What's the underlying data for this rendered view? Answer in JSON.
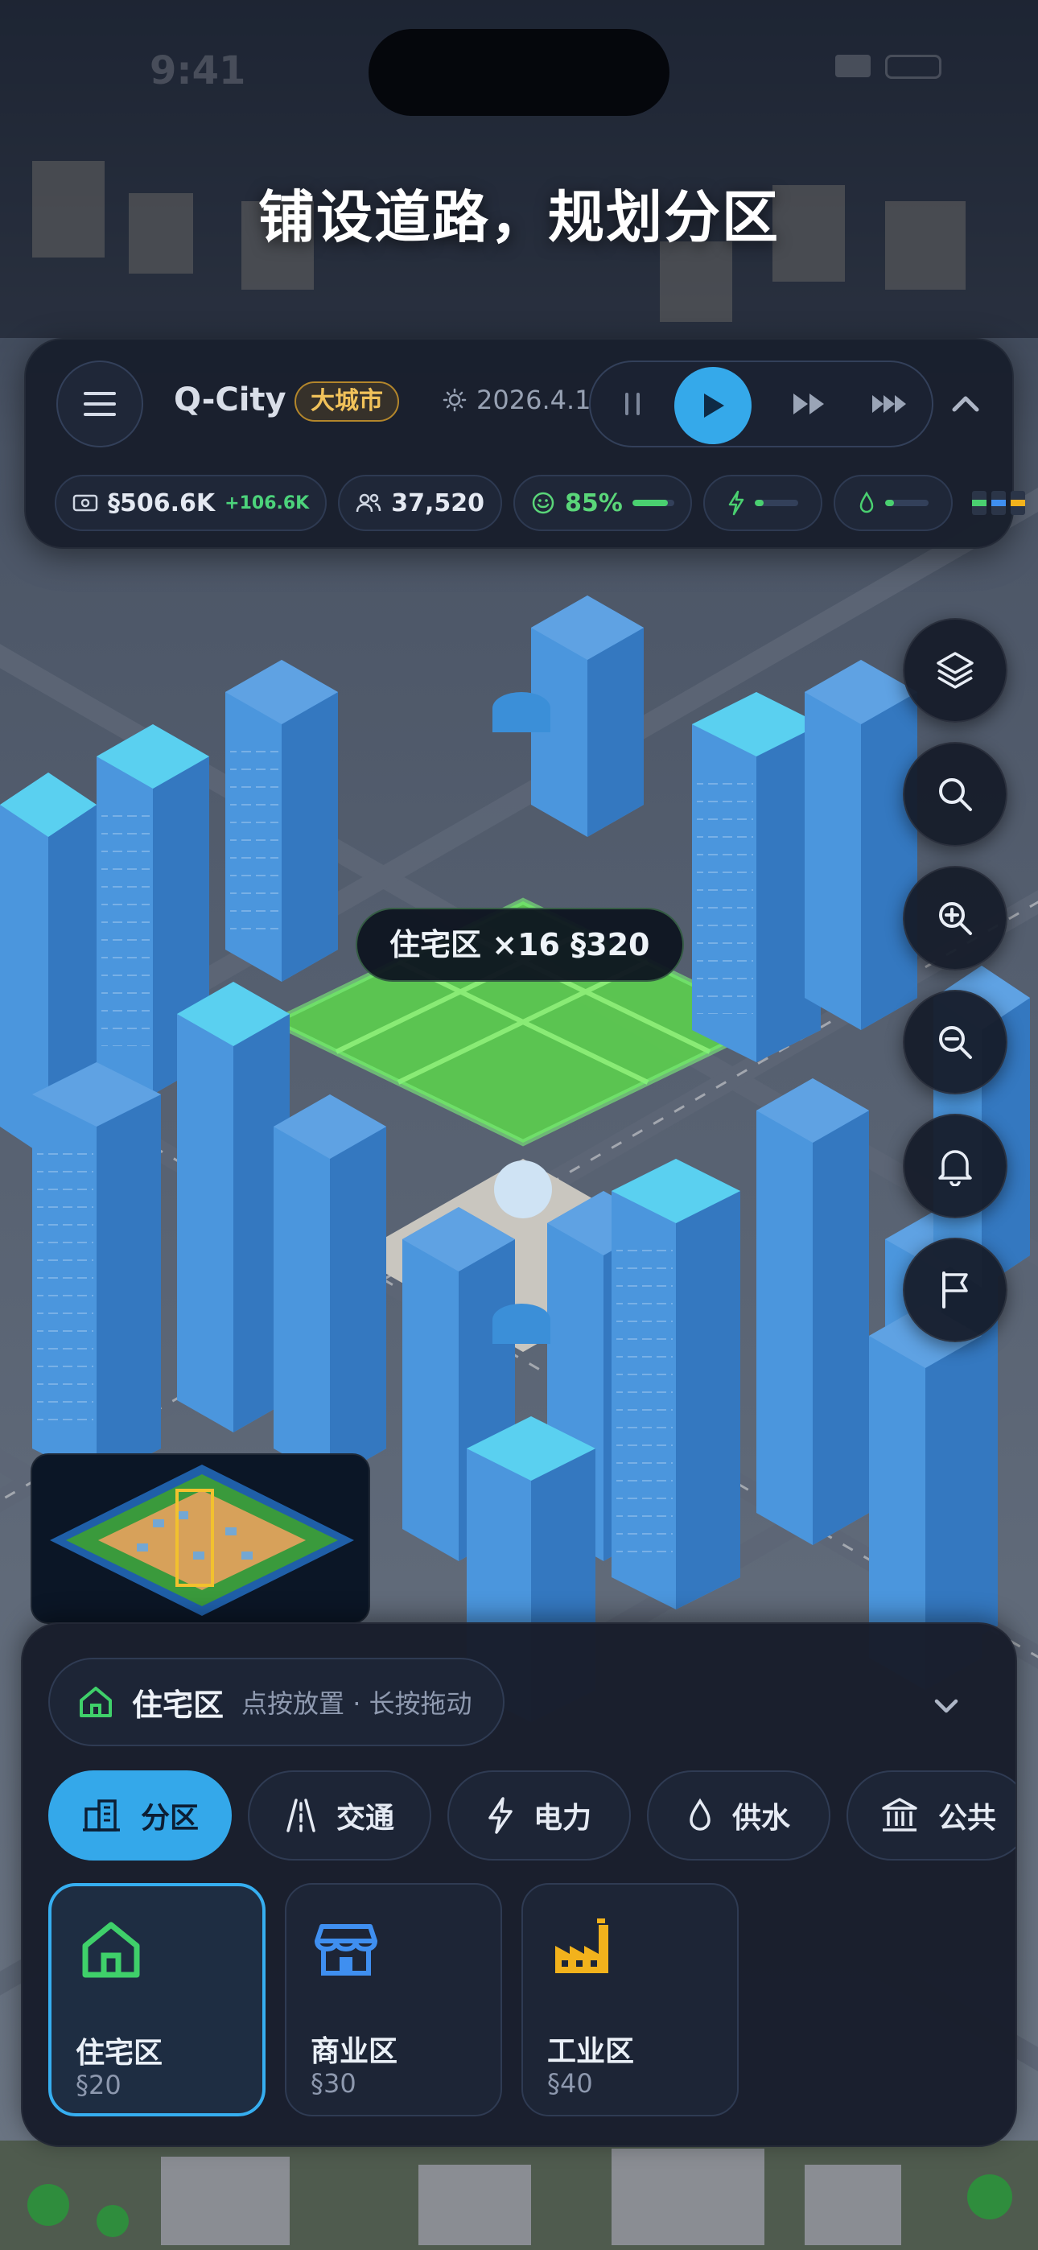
{
  "status_bar": {
    "time": "9:41"
  },
  "headline": "铺设道路，规划分区",
  "hud": {
    "city_name": "Q-City",
    "city_tier": "大城市",
    "date": "2026.4.1",
    "stats": {
      "money": "§506.6K",
      "money_delta": "+106.6K",
      "population": "37,520",
      "happiness": "85%",
      "happiness_level": 0.85,
      "power_level": 0.2,
      "water_level": 0.2
    }
  },
  "side_tools": [
    "layers-icon",
    "search-icon",
    "zoom-in-icon",
    "zoom-out-icon",
    "bell-icon",
    "flag-icon"
  ],
  "placement_tip": "住宅区 ×16  §320",
  "panel": {
    "selected": {
      "name": "住宅区",
      "hint": "点按放置 · 长按拖动"
    },
    "categories": [
      {
        "label": "分区",
        "icon": "buildings-icon",
        "active": true
      },
      {
        "label": "交通",
        "icon": "road-icon",
        "active": false
      },
      {
        "label": "电力",
        "icon": "lightning-icon",
        "active": false
      },
      {
        "label": "供水",
        "icon": "water-drop-icon",
        "active": false
      },
      {
        "label": "公共",
        "icon": "civic-building-icon",
        "active": false
      }
    ],
    "items": [
      {
        "name": "住宅区",
        "price": "§20",
        "icon": "house-icon",
        "color": "#3fd06a",
        "active": true
      },
      {
        "name": "商业区",
        "price": "§30",
        "icon": "shop-icon",
        "color": "#3f8ff0",
        "active": false
      },
      {
        "name": "工业区",
        "price": "§40",
        "icon": "factory-icon",
        "color": "#f2b21c",
        "active": false
      }
    ]
  },
  "colors": {
    "accent": "#35a9ea",
    "residential": "#3fd06a",
    "commercial": "#3f8ff0",
    "industrial": "#f2b21c",
    "tier_badge": "#f1c25a"
  }
}
